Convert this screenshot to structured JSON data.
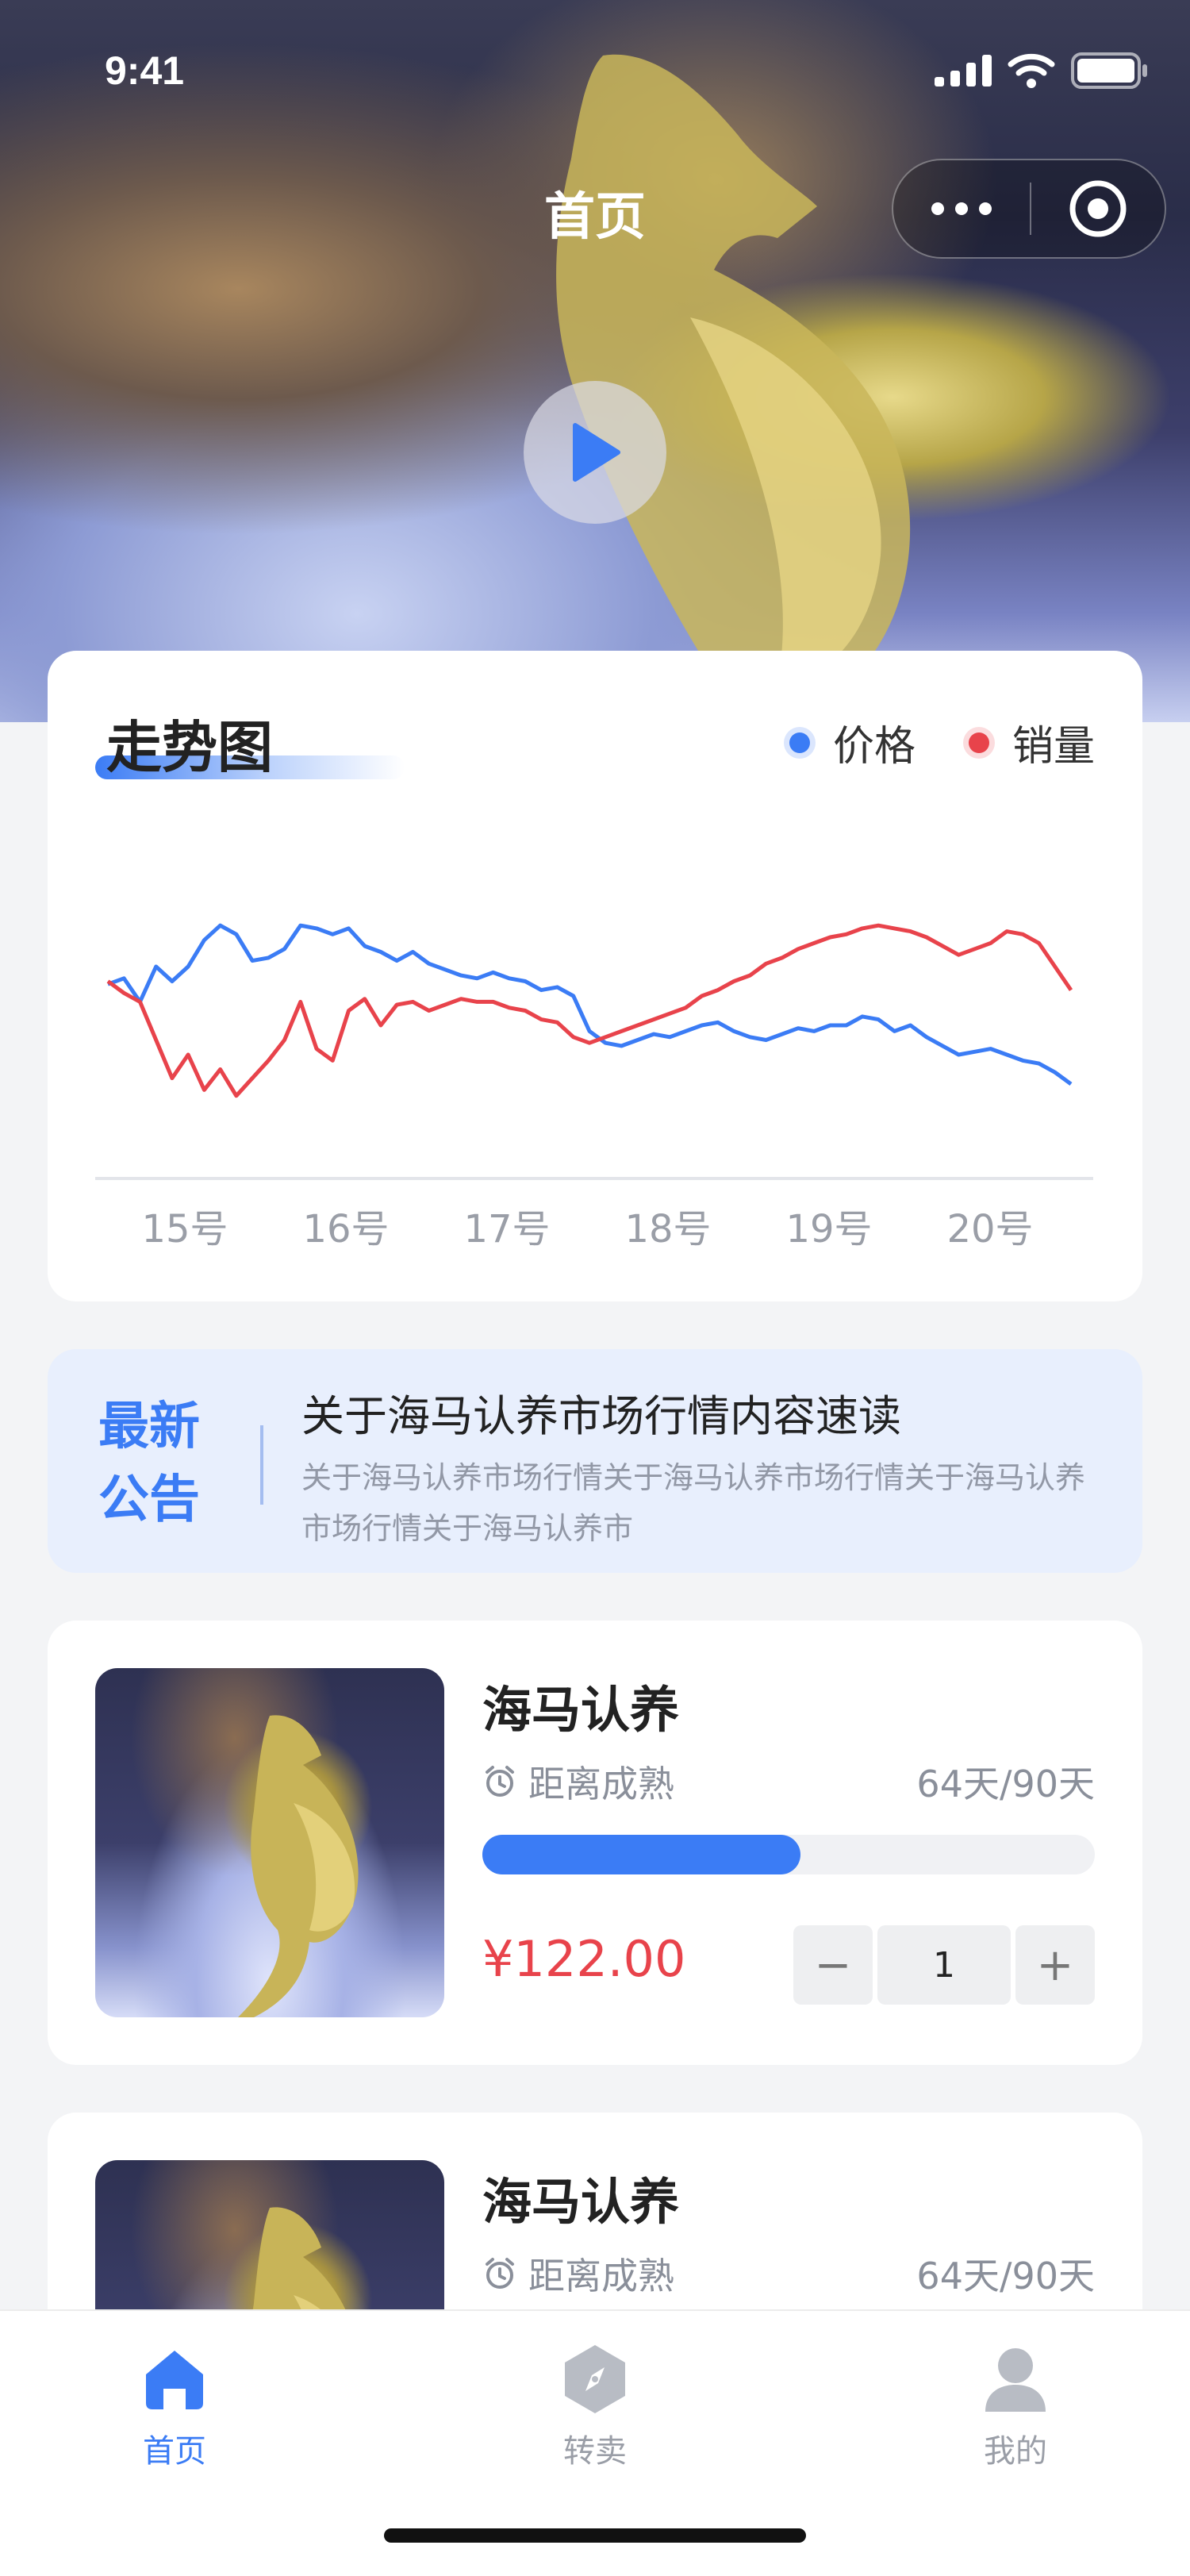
{
  "status_bar": {
    "time": "9:41"
  },
  "nav": {
    "title": "首页"
  },
  "trend": {
    "title": "走势图",
    "legend": [
      {
        "label": "价格",
        "color": "#3b7cf5"
      },
      {
        "label": "销量",
        "color": "#e8434b"
      }
    ]
  },
  "chart_data": {
    "type": "line",
    "title": "走势图",
    "x_tick_labels": [
      "15号",
      "16号",
      "17号",
      "18号",
      "19号",
      "20号"
    ],
    "series": [
      {
        "name": "价格",
        "color": "#3b7cf5",
        "values": [
          54,
          56,
          48,
          60,
          55,
          60,
          69,
          74,
          71,
          62,
          63,
          66,
          74,
          73,
          71,
          73,
          67,
          65,
          62,
          65,
          61,
          59,
          57,
          56,
          58,
          56,
          55,
          52,
          53,
          50,
          38,
          34,
          33,
          35,
          37,
          36,
          38,
          40,
          41,
          38,
          36,
          35,
          37,
          39,
          38,
          40,
          40,
          43,
          42,
          38,
          40,
          36,
          33,
          30,
          31,
          32,
          30,
          28,
          27,
          24,
          20
        ]
      },
      {
        "name": "销量",
        "color": "#e8434b",
        "values": [
          55,
          51,
          48,
          35,
          22,
          30,
          18,
          25,
          16,
          22,
          28,
          35,
          48,
          32,
          28,
          45,
          49,
          40,
          47,
          48,
          45,
          47,
          49,
          48,
          48,
          46,
          45,
          42,
          41,
          36,
          34,
          36,
          38,
          40,
          42,
          44,
          46,
          50,
          52,
          55,
          57,
          61,
          63,
          66,
          68,
          70,
          71,
          73,
          74,
          73,
          72,
          70,
          67,
          64,
          66,
          68,
          72,
          71,
          68,
          60,
          52
        ]
      }
    ]
  },
  "notice": {
    "tag": "最新公告",
    "title": "关于海马认养市场行情内容速读",
    "text": "关于海马认养市场行情关于海马认养市场行情关于海马认养市场行情关于海马认养市"
  },
  "products": [
    {
      "name": "海马认养",
      "maturity_label": "距离成熟",
      "days": "64天/90天",
      "progress": 0.52,
      "price": "¥122.00",
      "quantity": "1",
      "minus": "−",
      "plus": "+"
    },
    {
      "name": "海马认养",
      "maturity_label": "距离成熟",
      "days": "64天/90天"
    }
  ],
  "tabbar": [
    {
      "label": "首页",
      "icon": "home-icon",
      "active": true
    },
    {
      "label": "转卖",
      "icon": "compass-icon",
      "active": false
    },
    {
      "label": "我的",
      "icon": "user-icon",
      "active": false
    }
  ]
}
